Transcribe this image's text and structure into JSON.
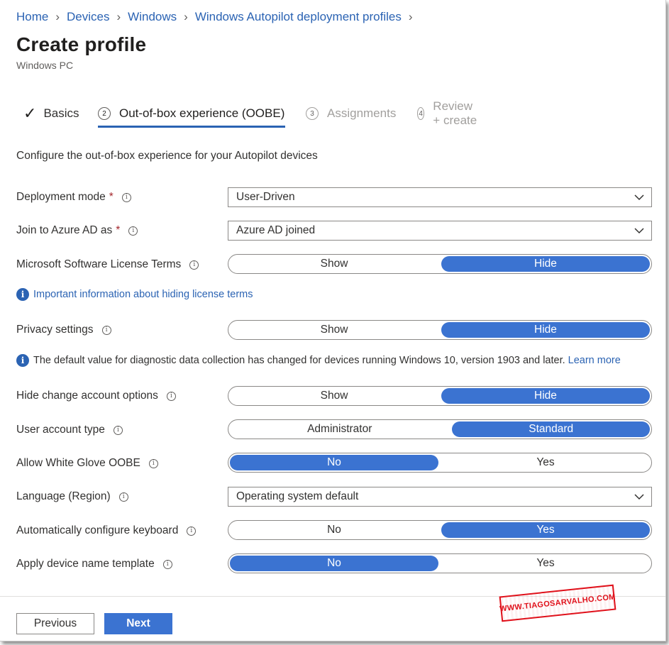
{
  "breadcrumb": [
    "Home",
    "Devices",
    "Windows",
    "Windows Autopilot deployment profiles"
  ],
  "page": {
    "title": "Create profile",
    "subtitle": "Windows PC"
  },
  "tabs": [
    {
      "num": "",
      "label": "Basics",
      "state": "done"
    },
    {
      "num": "2",
      "label": "Out-of-box experience (OOBE)",
      "state": "active"
    },
    {
      "num": "3",
      "label": "Assignments",
      "state": "disabled"
    },
    {
      "num": "4",
      "label": "Review + create",
      "state": "disabled"
    }
  ],
  "intro": "Configure the out-of-box experience for your Autopilot devices",
  "fields": {
    "deployment_mode": {
      "label": "Deployment mode",
      "value": "User-Driven"
    },
    "join_azure_ad": {
      "label": "Join to Azure AD as",
      "value": "Azure AD joined"
    },
    "license_terms": {
      "label": "Microsoft Software License Terms",
      "left": "Show",
      "right": "Hide",
      "selected": "right"
    },
    "license_notice": "Important information about hiding license terms",
    "privacy": {
      "label": "Privacy settings",
      "left": "Show",
      "right": "Hide",
      "selected": "right"
    },
    "privacy_notice": {
      "text": "The default value for diagnostic data collection has changed for devices running Windows 10, version 1903 and later.",
      "link": "Learn more"
    },
    "hide_change_account": {
      "label": "Hide change account options",
      "left": "Show",
      "right": "Hide",
      "selected": "right"
    },
    "user_account_type": {
      "label": "User account type",
      "left": "Administrator",
      "right": "Standard",
      "selected": "right"
    },
    "white_glove": {
      "label": "Allow White Glove OOBE",
      "left": "No",
      "right": "Yes",
      "selected": "left"
    },
    "language": {
      "label": "Language (Region)",
      "value": "Operating system default"
    },
    "auto_keyboard": {
      "label": "Automatically configure keyboard",
      "left": "No",
      "right": "Yes",
      "selected": "right"
    },
    "device_name_template": {
      "label": "Apply device name template",
      "left": "No",
      "right": "Yes",
      "selected": "left"
    }
  },
  "footer": {
    "previous": "Previous",
    "next": "Next"
  },
  "watermark": "WWW.TIAGOSARVALHO.COM",
  "colors": {
    "accent": "#3b73d1",
    "link": "#2b63b3",
    "required": "#a4262c"
  }
}
